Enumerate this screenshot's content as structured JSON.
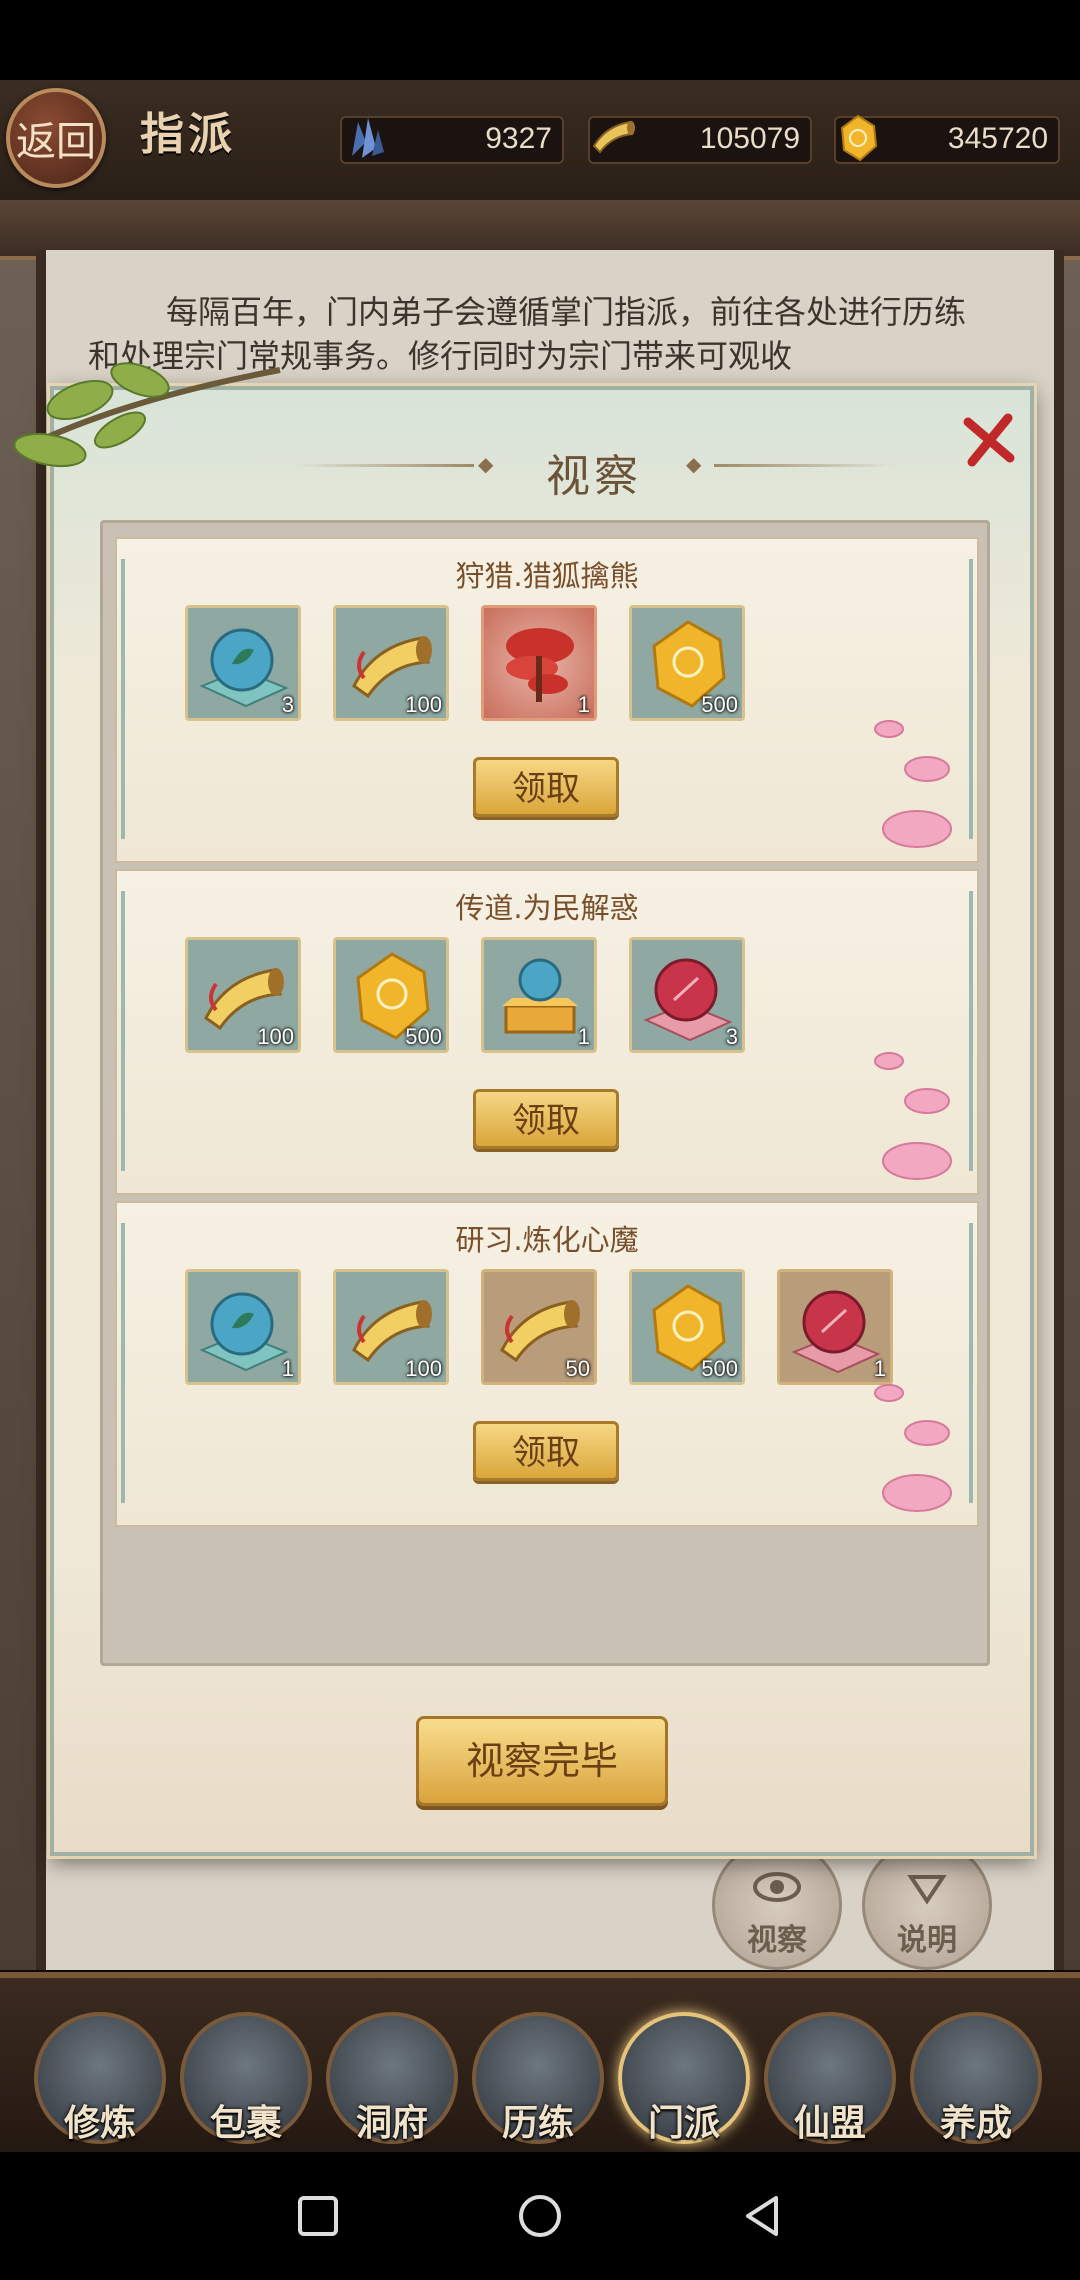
{
  "header": {
    "back_label": "返回",
    "title": "指派",
    "resources": [
      {
        "icon": "crystal-icon",
        "value": "9327"
      },
      {
        "icon": "horn-icon",
        "value": "105079"
      },
      {
        "icon": "gold-stone-icon",
        "value": "345720"
      }
    ]
  },
  "intro_text": "每隔百年，门内弟子会遵循掌门指派，前往各处进行历练和处理宗门常规事务。修行同时为宗门带来可观收",
  "modal": {
    "title": "视察",
    "close_icon": "close-x-icon",
    "tasks": [
      {
        "name": "狩猎.猎狐擒熊",
        "claim_label": "领取",
        "items": [
          {
            "icon": "teal-orb-icon",
            "count": "3"
          },
          {
            "icon": "horn-icon",
            "count": "100"
          },
          {
            "icon": "red-lingzhi-icon",
            "count": "1"
          },
          {
            "icon": "gold-stone-icon",
            "count": "500"
          }
        ]
      },
      {
        "name": "传道.为民解惑",
        "claim_label": "领取",
        "items": [
          {
            "icon": "horn-icon",
            "count": "100"
          },
          {
            "icon": "gold-stone-icon",
            "count": "500"
          },
          {
            "icon": "orb-on-pedestal-icon",
            "count": "1"
          },
          {
            "icon": "red-orb-icon",
            "count": "3"
          }
        ]
      },
      {
        "name": "研习.炼化心魔",
        "claim_label": "领取",
        "items": [
          {
            "icon": "teal-orb-icon",
            "count": "1"
          },
          {
            "icon": "horn-icon",
            "count": "100"
          },
          {
            "icon": "horn-icon",
            "count": "50"
          },
          {
            "icon": "gold-stone-icon",
            "count": "500"
          },
          {
            "icon": "red-orb-icon",
            "count": "1"
          }
        ]
      }
    ],
    "finish_label": "视察完毕"
  },
  "side_buttons": [
    {
      "label": "视察",
      "icon": "eye-icon"
    },
    {
      "label": "说明",
      "icon": "info-icon"
    }
  ],
  "bottom_nav": [
    {
      "label": "修炼",
      "active": false
    },
    {
      "label": "包裹",
      "active": false
    },
    {
      "label": "洞府",
      "active": false
    },
    {
      "label": "历练",
      "active": false
    },
    {
      "label": "门派",
      "active": true
    },
    {
      "label": "仙盟",
      "active": false
    },
    {
      "label": "养成",
      "active": false
    }
  ],
  "colors": {
    "accent_gold": "#d9a63a",
    "title_brown": "#6c5238",
    "task_text": "#7a4f2b"
  }
}
